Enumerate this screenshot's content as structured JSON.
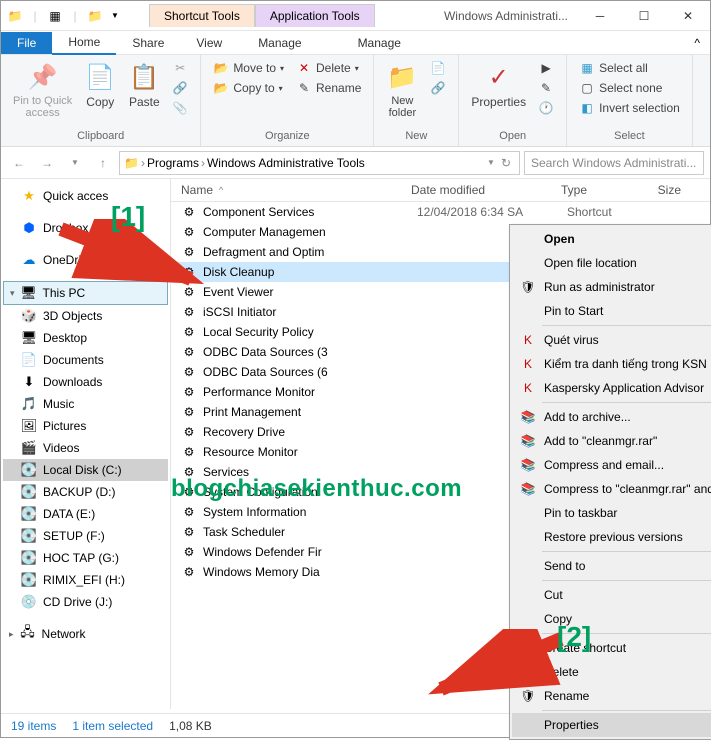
{
  "title": "Windows Administrati...",
  "title_tools": {
    "shortcut": "Shortcut Tools",
    "app": "Application Tools"
  },
  "menu": {
    "file": "File",
    "home": "Home",
    "share": "Share",
    "view": "View",
    "manage1": "Manage",
    "manage2": "Manage"
  },
  "ribbon": {
    "clipboard": {
      "label": "Clipboard",
      "pin": "Pin to Quick\naccess",
      "copy": "Copy",
      "paste": "Paste"
    },
    "organize": {
      "label": "Organize",
      "move": "Move to",
      "copy": "Copy to",
      "delete": "Delete",
      "rename": "Rename"
    },
    "new": {
      "label": "New",
      "folder": "New\nfolder"
    },
    "open": {
      "label": "Open",
      "properties": "Properties"
    },
    "select": {
      "label": "Select",
      "all": "Select all",
      "none": "Select none",
      "invert": "Invert selection"
    }
  },
  "breadcrumb": [
    "Programs",
    "Windows Administrative Tools"
  ],
  "search_placeholder": "Search Windows Administrati...",
  "columns": {
    "name": "Name",
    "date": "Date modified",
    "type": "Type",
    "size": "Size"
  },
  "nav": {
    "quick": "Quick acces",
    "dropbox": "Dropbox",
    "onedrive": "OneDrive",
    "thispc": "This PC",
    "items": [
      "3D Objects",
      "Desktop",
      "Documents",
      "Downloads",
      "Music",
      "Pictures",
      "Videos",
      "Local Disk (C:)",
      "BACKUP (D:)",
      "DATA (E:)",
      "SETUP (F:)",
      "HOC TAP (G:)",
      "RIMIX_EFI (H:)",
      "CD Drive (J:)"
    ],
    "network": "Network"
  },
  "files": [
    {
      "name": "Component Services",
      "date": "12/04/2018 6:34 SA",
      "type": "Shortcut"
    },
    {
      "name": "Computer Managemen"
    },
    {
      "name": "Defragment and Optim"
    },
    {
      "name": "Disk Cleanup",
      "sel": true
    },
    {
      "name": "Event Viewer"
    },
    {
      "name": "iSCSI Initiator"
    },
    {
      "name": "Local Security Policy"
    },
    {
      "name": "ODBC Data Sources (3"
    },
    {
      "name": "ODBC Data Sources (6"
    },
    {
      "name": "Performance Monitor"
    },
    {
      "name": "Print Management"
    },
    {
      "name": "Recovery Drive"
    },
    {
      "name": "Resource Monitor"
    },
    {
      "name": "Services"
    },
    {
      "name": "System Configuration"
    },
    {
      "name": "System Information"
    },
    {
      "name": "Task Scheduler"
    },
    {
      "name": "Windows Defender Fir"
    },
    {
      "name": "Windows Memory Dia"
    }
  ],
  "context": {
    "open": "Open",
    "open_loc": "Open file location",
    "run_admin": "Run as administrator",
    "pin_start": "Pin to Start",
    "scan": "Quét virus",
    "ksn": "Kiểm tra danh tiếng trong KSN",
    "kav": "Kaspersky Application Advisor",
    "archive": "Add to archive...",
    "rar": "Add to \"cleanmgr.rar\"",
    "compress": "Compress and email...",
    "compress_rar": "Compress to \"cleanmgr.rar\" and email",
    "pin_tb": "Pin to taskbar",
    "restore": "Restore previous versions",
    "sendto": "Send to",
    "cut": "Cut",
    "copy": "Copy",
    "shortcut": "Create shortcut",
    "delete": "Delete",
    "rename": "Rename",
    "properties": "Properties"
  },
  "status": {
    "count": "19 items",
    "sel": "1 item selected",
    "size": "1,08 KB"
  },
  "annotations": {
    "a1": "[1]",
    "a2": "[2]"
  },
  "watermark": "blogchiasekienthuc.com"
}
